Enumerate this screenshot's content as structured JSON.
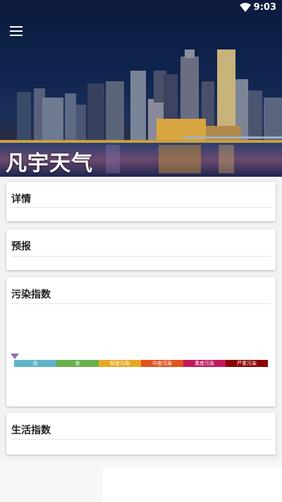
{
  "status_bar": {
    "time": "9:03"
  },
  "app": {
    "title": "凡宇天气"
  },
  "cards": {
    "details": {
      "title": "详情"
    },
    "forecast": {
      "title": "预报"
    },
    "pollution": {
      "title": "污染指数",
      "levels": [
        {
          "label": "优",
          "color": "#5fb3c8"
        },
        {
          "label": "良",
          "color": "#6ab04c"
        },
        {
          "label": "轻度污染",
          "color": "#e5a823"
        },
        {
          "label": "中度污染",
          "color": "#e0531d"
        },
        {
          "label": "重度污染",
          "color": "#c2185b"
        },
        {
          "label": "严重污染",
          "color": "#8b0000"
        }
      ],
      "pointer_color": "#8e6fb8"
    },
    "life": {
      "title": "生活指数"
    }
  },
  "icons": {
    "menu": "menu-icon",
    "wifi": "wifi-icon"
  }
}
